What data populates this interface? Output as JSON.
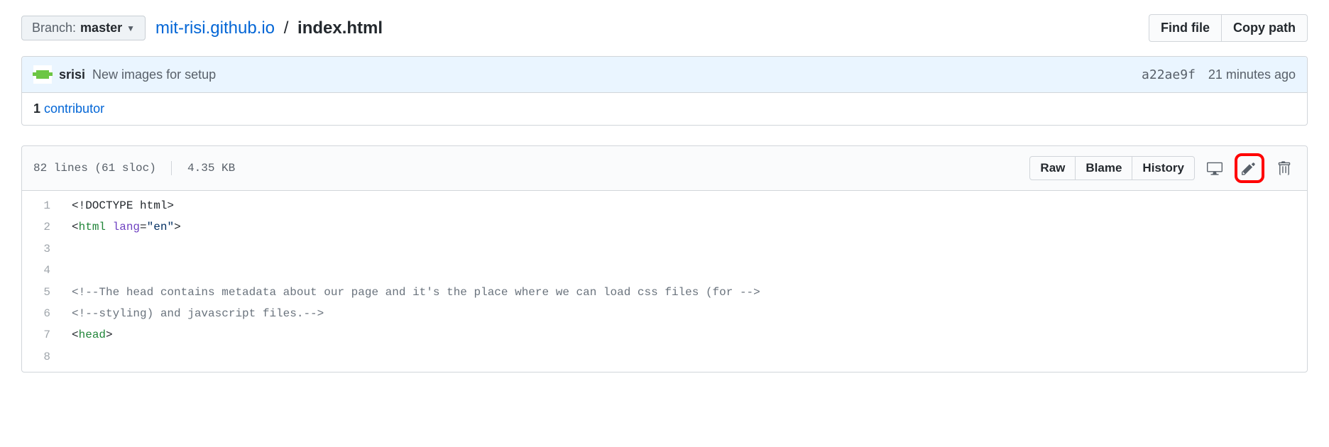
{
  "branch": {
    "label": "Branch:",
    "name": "master"
  },
  "breadcrumb": {
    "repo": "mit-risi.github.io",
    "sep": "/",
    "file": "index.html"
  },
  "buttons": {
    "find_file": "Find file",
    "copy_path": "Copy path",
    "raw": "Raw",
    "blame": "Blame",
    "history": "History"
  },
  "commit": {
    "author": "srisi",
    "message": "New images for setup",
    "sha": "a22ae9f",
    "time": "21 minutes ago"
  },
  "contributors": {
    "count": "1",
    "label": "contributor"
  },
  "file_info": {
    "lines": "82 lines (61 sloc)",
    "size": "4.35 KB"
  },
  "code": {
    "l1": {
      "num": "1"
    },
    "l2": {
      "num": "2"
    },
    "l3": {
      "num": "3"
    },
    "l4": {
      "num": "4"
    },
    "l5": {
      "num": "5",
      "text": "<!--The head contains metadata about our page and it's the place where we can load css files (for -->"
    },
    "l6": {
      "num": "6",
      "text": "<!--styling) and javascript files.-->"
    },
    "l7": {
      "num": "7"
    },
    "l8": {
      "num": "8"
    }
  },
  "tokens": {
    "doctype_open": "<!DOCTYPE ",
    "doctype_name": "html",
    "doctype_close": ">",
    "html_open_lt": "<",
    "html_tag": "html",
    "html_space": " ",
    "lang_attr": "lang",
    "eq": "=",
    "quote": "\"",
    "lang_val": "en",
    "gt": ">",
    "head_open_lt": "<",
    "head_tag": "head",
    "head_gt": ">"
  }
}
